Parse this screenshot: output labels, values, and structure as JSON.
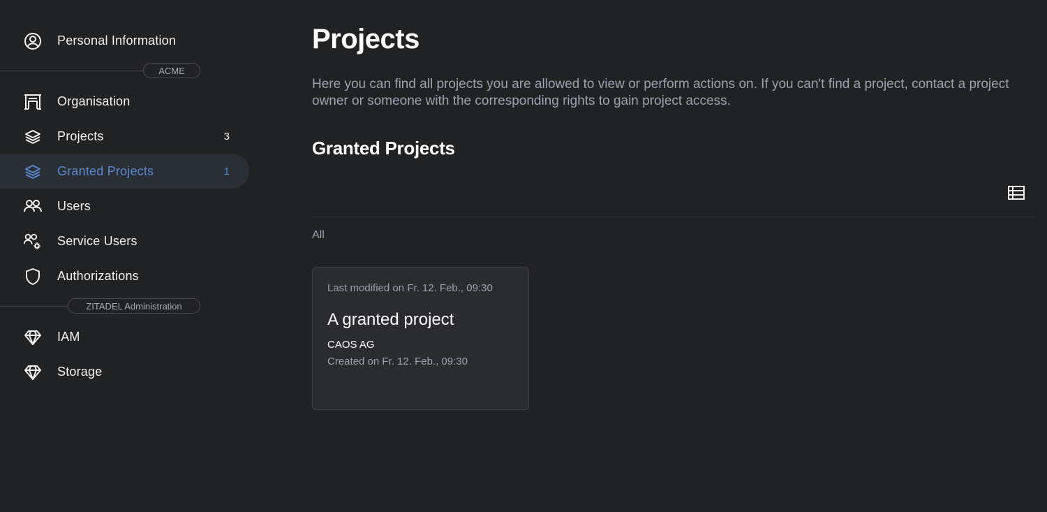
{
  "sidebar": {
    "personal": {
      "label": "Personal Information",
      "icon": "user-circle-icon"
    },
    "sections": {
      "org": "ACME",
      "admin": "ZITADEL Administration"
    },
    "items": [
      {
        "label": "Organisation",
        "icon": "building-icon",
        "count": ""
      },
      {
        "label": "Projects",
        "icon": "layers-icon",
        "count": "3"
      },
      {
        "label": "Granted Projects",
        "icon": "layers-icon",
        "count": "1",
        "active": true
      },
      {
        "label": "Users",
        "icon": "users-icon",
        "count": ""
      },
      {
        "label": "Service Users",
        "icon": "users-gear-icon",
        "count": ""
      },
      {
        "label": "Authorizations",
        "icon": "shield-icon",
        "count": ""
      }
    ],
    "admin_items": [
      {
        "label": "IAM",
        "icon": "diamond-icon"
      },
      {
        "label": "Storage",
        "icon": "diamond-icon"
      }
    ],
    "active_color": "#5a87cc"
  },
  "main": {
    "title": "Projects",
    "description": "Here you can find all projects you are allowed to view or perform actions on. If you can't find a project, contact a project owner or someone with the corresponding rights to gain project access.",
    "section_title": "Granted Projects",
    "filter_label": "All",
    "view_toggle_icon": "list-view-icon",
    "cards": [
      {
        "modified": "Last modified on Fr. 12. Feb., 09:30",
        "name": "A granted project",
        "org": "CAOS AG",
        "created": "Created on Fr. 12. Feb., 09:30"
      }
    ]
  }
}
